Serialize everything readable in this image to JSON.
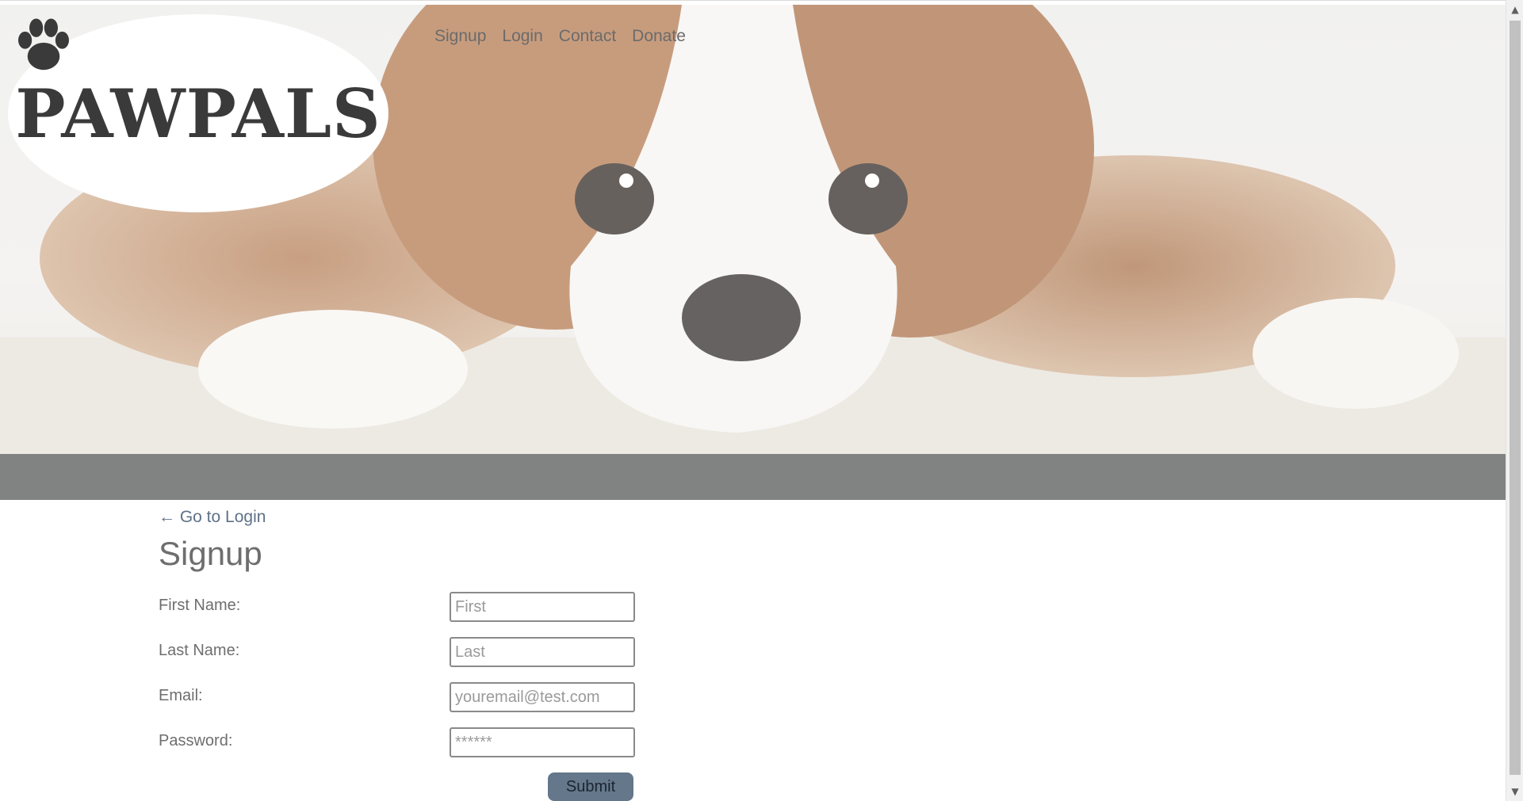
{
  "logo": {
    "text_left": "PAW",
    "text_right": "PALS"
  },
  "nav": {
    "items": [
      "Signup",
      "Login",
      "Contact",
      "Donate"
    ]
  },
  "form": {
    "back_link": "← Go to Login",
    "title": "Signup",
    "fields": [
      {
        "label": "First Name:",
        "placeholder": "First"
      },
      {
        "label": "Last Name:",
        "placeholder": "Last"
      },
      {
        "label": "Email:",
        "placeholder": "youremail@test.com"
      },
      {
        "label": "Password:",
        "placeholder": "******"
      }
    ],
    "submit_label": "Submit"
  },
  "colors": {
    "band": "#818383",
    "submit": "#64778b",
    "link": "#5e7187"
  }
}
